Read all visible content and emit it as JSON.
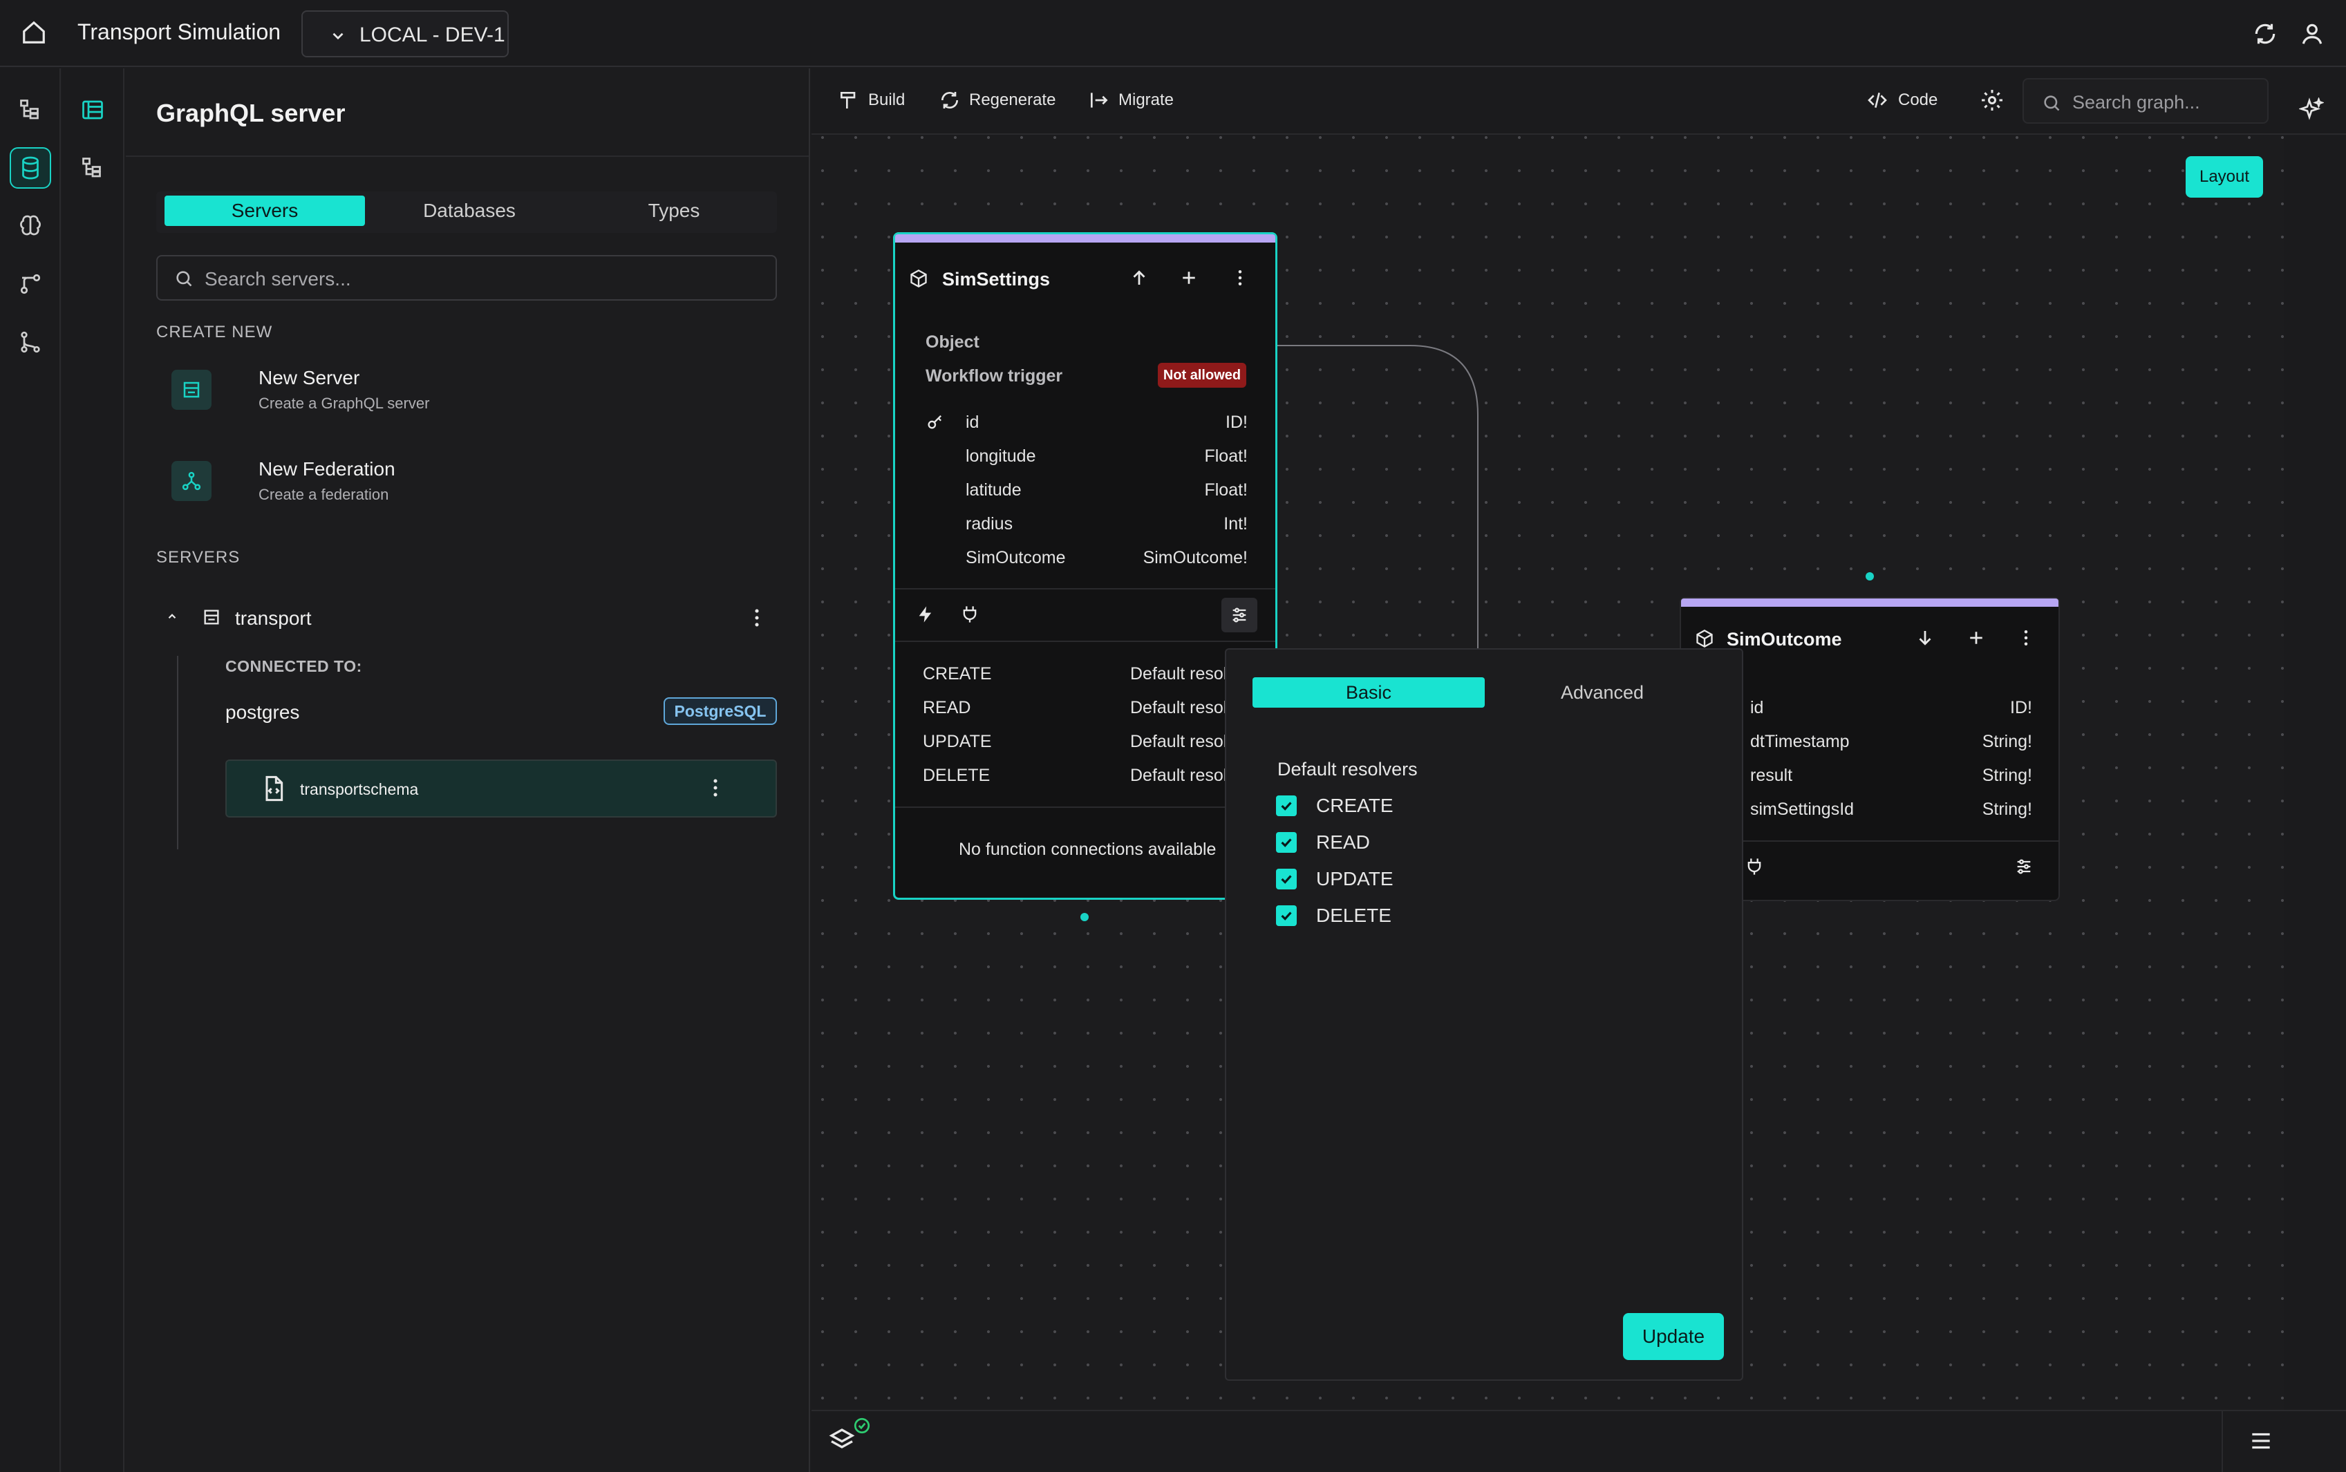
{
  "app": {
    "title": "Transport Simulation",
    "environment": "LOCAL - DEV-1"
  },
  "panel": {
    "title": "GraphQL server",
    "tabs": [
      "Servers",
      "Databases",
      "Types"
    ],
    "search_placeholder": "Search servers...",
    "create_new_label": "CREATE NEW",
    "create_items": [
      {
        "title": "New Server",
        "subtitle": "Create a GraphQL server"
      },
      {
        "title": "New Federation",
        "subtitle": "Create a federation"
      }
    ],
    "servers_label": "SERVERS",
    "server": {
      "name": "transport",
      "connected_label": "CONNECTED TO:",
      "db_name": "postgres",
      "db_badge": "PostgreSQL",
      "schema": "transportschema"
    }
  },
  "toolbar": {
    "build": "Build",
    "regenerate": "Regenerate",
    "migrate": "Migrate",
    "code": "Code",
    "search_placeholder": "Search graph..."
  },
  "canvas": {
    "layout_button": "Layout"
  },
  "sim_settings": {
    "title": "SimSettings",
    "kind": "Object",
    "workflow_label": "Workflow trigger",
    "workflow_badge": "Not allowed",
    "fields": [
      {
        "name": "id",
        "type": "ID!"
      },
      {
        "name": "longitude",
        "type": "Float!"
      },
      {
        "name": "latitude",
        "type": "Float!"
      },
      {
        "name": "radius",
        "type": "Int!"
      },
      {
        "name": "SimOutcome",
        "type": "SimOutcome!"
      }
    ],
    "operations": [
      {
        "name": "CREATE",
        "value": "Default resol"
      },
      {
        "name": "READ",
        "value": "Default resol"
      },
      {
        "name": "UPDATE",
        "value": "Default resol"
      },
      {
        "name": "DELETE",
        "value": "Default resol"
      }
    ],
    "no_functions": "No function connections available"
  },
  "sim_outcome": {
    "title": "SimOutcome",
    "fields": [
      {
        "name": "id",
        "type": "ID!"
      },
      {
        "name": "dtTimestamp",
        "type": "String!"
      },
      {
        "name": "result",
        "type": "String!"
      },
      {
        "name": "simSettingsId",
        "type": "String!"
      }
    ]
  },
  "popover": {
    "tabs": [
      "Basic",
      "Advanced"
    ],
    "heading": "Default resolvers",
    "checks": [
      "CREATE",
      "READ",
      "UPDATE",
      "DELETE"
    ],
    "update": "Update"
  },
  "colors": {
    "accent": "#19e3d1",
    "node_top": "#b7a6f3",
    "danger": "#8f1a1a",
    "badge_blue": "#5fa7d9"
  }
}
